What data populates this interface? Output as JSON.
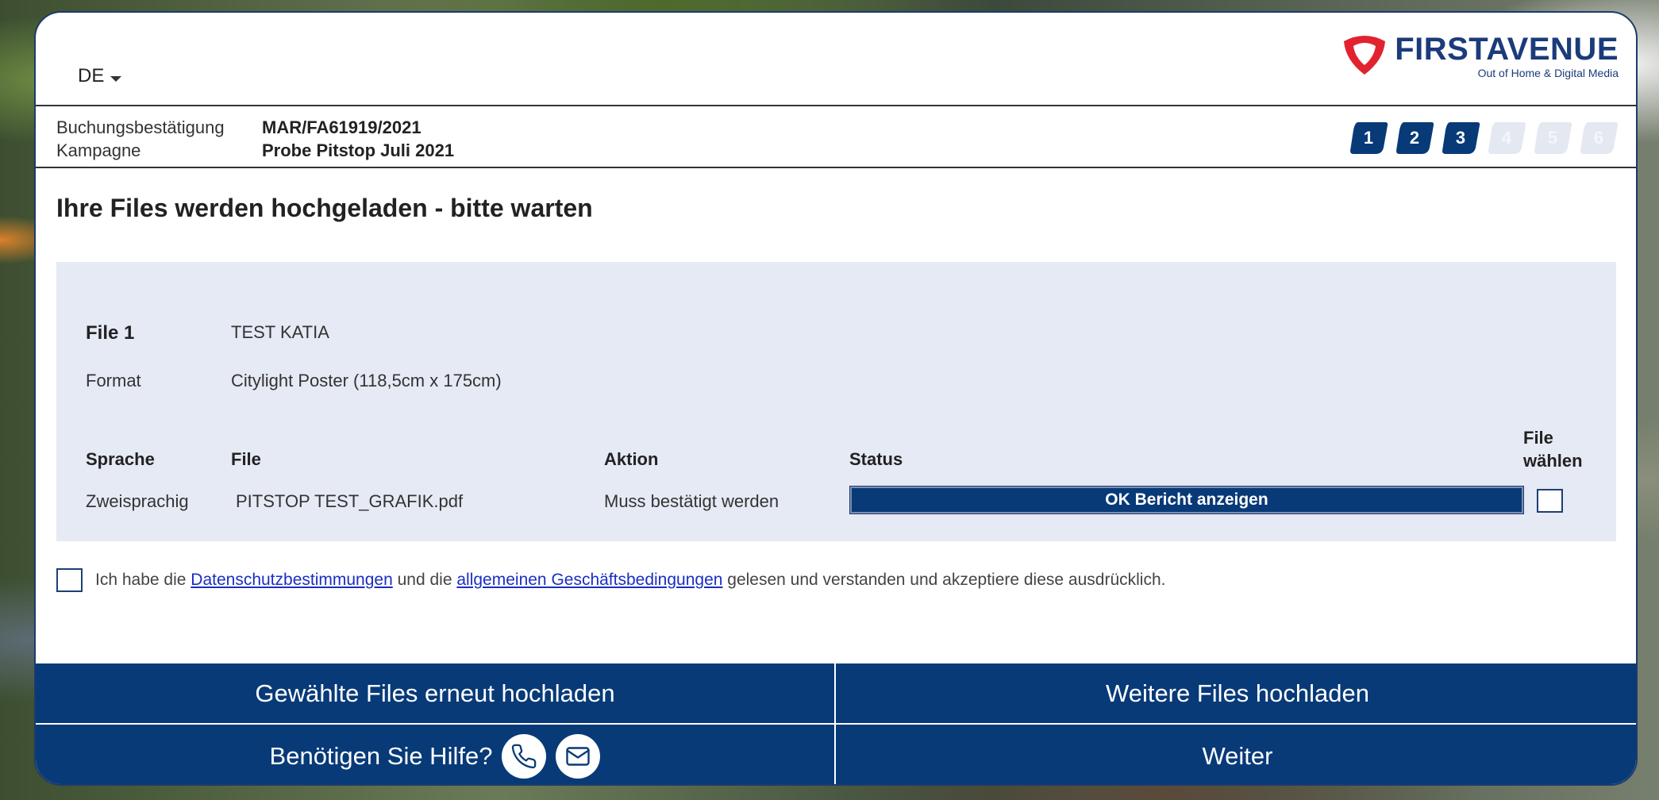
{
  "header": {
    "language": "DE",
    "logo_name": "FIRSTAVENUE",
    "logo_tagline": "Out of Home & Digital Media"
  },
  "booking": {
    "label_confirmation": "Buchungsbestätigung",
    "label_campaign": "Kampagne",
    "confirmation_value": "MAR/FA61919/2021",
    "campaign_value": "Probe Pitstop Juli 2021"
  },
  "steps": {
    "items": [
      "1",
      "2",
      "3",
      "4",
      "5",
      "6"
    ],
    "active_count": 3,
    "active_color": "#083a78",
    "inactive_color": "#e4e8f1"
  },
  "page_title": "Ihre Files werden hochgeladen - bitte warten",
  "file": {
    "label": "File 1",
    "name": "TEST KATIA",
    "format_label": "Format",
    "format_value": "Citylight Poster (118,5cm x 175cm)",
    "columns": {
      "language": "Sprache",
      "file": "File",
      "action": "Aktion",
      "status": "Status",
      "select_line1": "File",
      "select_line2": "wählen"
    },
    "row": {
      "language": "Zweisprachig",
      "file": "PITSTOP TEST_GRAFIK.pdf",
      "action": "Muss bestätigt werden",
      "status_ok": "OK",
      "status_link": "Bericht anzeigen"
    }
  },
  "terms": {
    "prefix": "Ich habe die",
    "link1": "Datenschutzbestimmungen",
    "middle": "und die",
    "link2": "allgemeinen Geschäftsbedingungen",
    "suffix": "gelesen und verstanden und akzeptiere diese ausdrücklich."
  },
  "buttons": {
    "reupload": "Gewählte Files erneut hochladen",
    "upload_more": "Weitere Files hochladen",
    "help": "Benötigen Sie Hilfe?",
    "next": "Weiter"
  },
  "colors": {
    "primary": "#083a78",
    "panel": "#e6eaf5",
    "logo_red": "#e0232e"
  }
}
